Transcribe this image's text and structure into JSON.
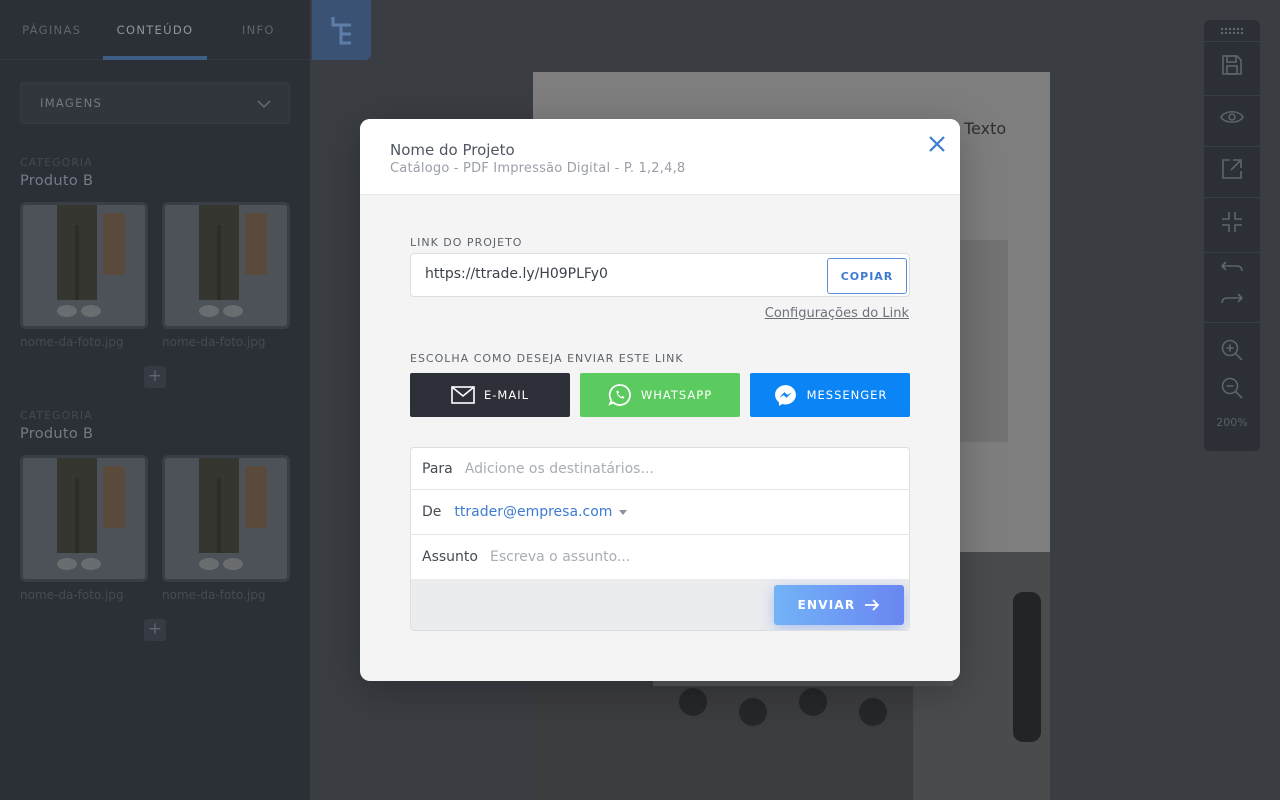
{
  "sidebar": {
    "tabs": [
      {
        "label": "PÁGINAS"
      },
      {
        "label": "CONTEÚDO"
      },
      {
        "label": "INFO"
      }
    ],
    "dropdown": {
      "label": "IMAGENS"
    },
    "categories": [
      {
        "label": "CATEGORIA",
        "name": "Produto B",
        "photos": [
          {
            "caption": "nome-da-foto.jpg"
          },
          {
            "caption": "nome-da-foto.jpg"
          }
        ]
      },
      {
        "label": "CATEGORIA",
        "name": "Produto B",
        "photos": [
          {
            "caption": "nome-da-foto.jpg"
          },
          {
            "caption": "nome-da-foto.jpg"
          }
        ]
      }
    ],
    "add_label": "+"
  },
  "canvas": {
    "text_fragment": "Texto"
  },
  "toolbar": {
    "zoom": "200%",
    "icons": [
      "save-icon",
      "eye-icon",
      "open-external-icon",
      "collapse-icon",
      "undo-icon",
      "redo-icon",
      "zoom-in-icon",
      "zoom-out-icon"
    ]
  },
  "modal": {
    "title": "Nome do Projeto",
    "subtitle": "Catálogo - PDF Impressão Digital -  P. 1,2,4,8",
    "link_label": "LINK DO PROJETO",
    "link_value": "https://ttrade.ly/H09PLFy0",
    "copy_label": "COPIAR",
    "config_link": "Configurações do Link",
    "share_label": "ESCOLHA COMO DESEJA ENVIAR ESTE LINK",
    "share_buttons": {
      "email": "E-MAIL",
      "whatsapp": "WHATSAPP",
      "messenger": "MESSENGER"
    },
    "form": {
      "to_label": "Para",
      "to_placeholder": "Adicione os destinatários...",
      "from_label": "De",
      "from_value": "ttrader@empresa.com",
      "subject_label": "Assunto",
      "subject_placeholder": "Escreva o assunto...",
      "send_label": "ENVIAR"
    }
  },
  "colors": {
    "accent": "#3f7bd0",
    "email_button": "#2d3038",
    "whatsapp_button": "#5ccb5f",
    "messenger_button": "#0b84f5"
  }
}
